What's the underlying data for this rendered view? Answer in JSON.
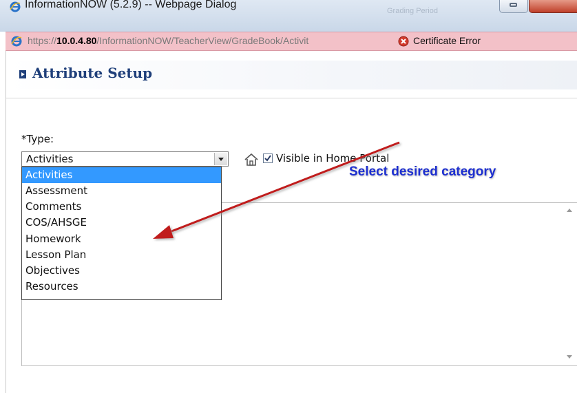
{
  "window": {
    "title": "InformationNOW (5.2.9) -- Webpage Dialog",
    "ghost_text": "Grading Period"
  },
  "address_bar": {
    "url_prefix": "https://",
    "url_host": "10.0.4.80",
    "url_path": "/InformationNOW/TeacherView/GradeBook/Activit",
    "certificate_label": "Certificate Error"
  },
  "page": {
    "title": "Attribute Setup",
    "type_label": "*Type:",
    "selected_type": "Activities",
    "type_options": [
      "Activities",
      "Assessment",
      "Comments",
      "COS/AHSGE",
      "Homework",
      "Lesson Plan",
      "Objectives",
      "Resources"
    ],
    "visible_label": "Visible in Home Portal",
    "visible_checked": true
  },
  "annotation": {
    "text": "Select desired category",
    "color": "#1d2fd0",
    "arrow_color": "#c01a1a"
  },
  "colors": {
    "address_bar_bg": "#f3c1c8",
    "title_color": "#1f3f7a",
    "selection_bg": "#3399ff"
  }
}
